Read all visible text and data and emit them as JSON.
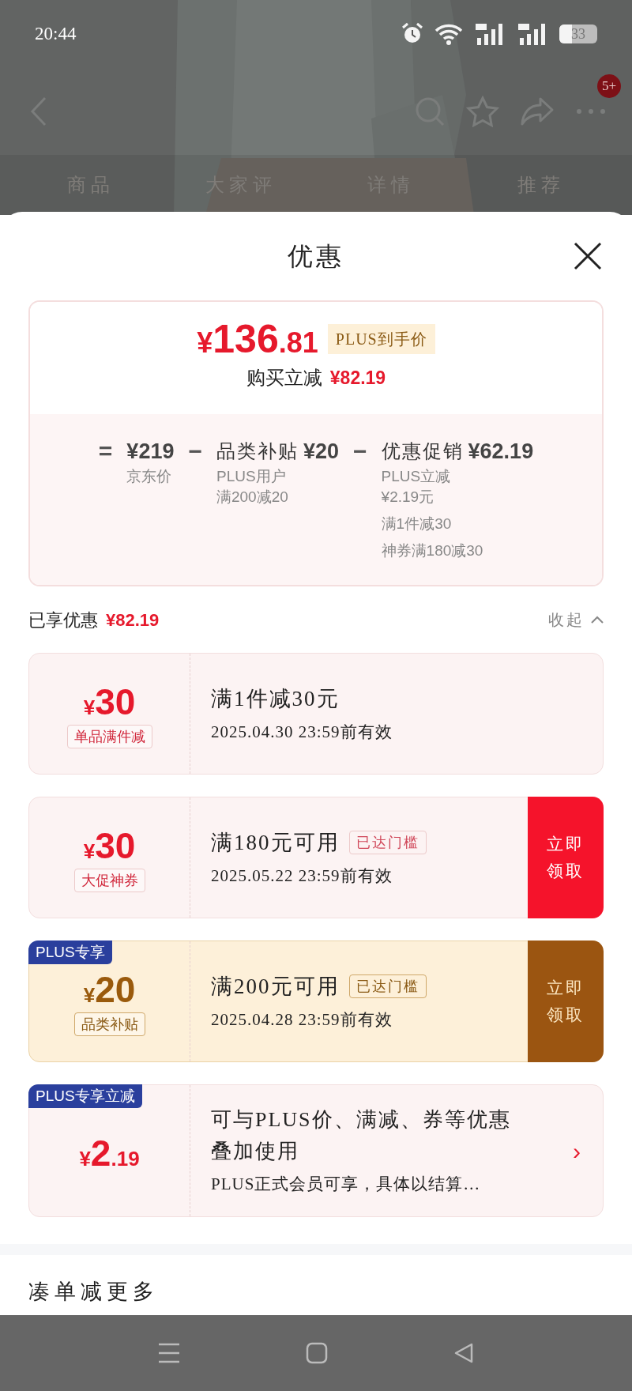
{
  "status_bar": {
    "time": "20:44",
    "battery": "33"
  },
  "nav": {
    "badge": "5+"
  },
  "tabs": [
    {
      "label": "商品"
    },
    {
      "label": "大家评"
    },
    {
      "label": "详情"
    },
    {
      "label": "推荐"
    }
  ],
  "sheet": {
    "title": "优惠"
  },
  "price_summary": {
    "currency": "¥",
    "integer": "136",
    "decimal": ".81",
    "tag": "PLUS到手价",
    "save_label": "购买立减",
    "save_amount": "¥82.19"
  },
  "breakdown": {
    "equals": "=",
    "items": [
      {
        "amount": "¥219",
        "notes": [
          [
            "京东价"
          ]
        ]
      },
      {
        "operator": "−",
        "label": "品类补贴",
        "amount": "¥20",
        "notes": [
          [
            "PLUS用户",
            "满200减20"
          ]
        ]
      },
      {
        "operator": "−",
        "label": "优惠促销",
        "amount": "¥62.19",
        "notes": [
          [
            "PLUS立减",
            "¥2.19元"
          ],
          [
            "满1件减30"
          ],
          [
            "神券满180减30"
          ]
        ]
      }
    ]
  },
  "enjoyed": {
    "label": "已享优惠",
    "amount": "¥82.19",
    "toggle": "收起"
  },
  "coupons": [
    {
      "kind": "coupon",
      "currency": "¥",
      "amount": "30",
      "tag": "单品满件减",
      "title": "满1件减30元",
      "validity": "2025.04.30 23:59前有效"
    },
    {
      "kind": "coupon",
      "currency": "¥",
      "amount": "30",
      "tag": "大促神券",
      "title": "满180元可用",
      "threshold": "已达门槛",
      "validity": "2025.05.22 23:59前有效",
      "action": [
        "立即",
        "领取"
      ]
    },
    {
      "kind": "plus",
      "badge": "PLUS专享",
      "currency": "¥",
      "amount": "20",
      "tag": "品类补贴",
      "title": "满200元可用",
      "threshold": "已达门槛",
      "validity": "2025.04.28 23:59前有效",
      "action": [
        "立即",
        "领取"
      ]
    },
    {
      "kind": "plus_instant",
      "badge": "PLUS专享立减",
      "currency": "¥",
      "amount": "2",
      "decimal": ".19",
      "title": "可与PLUS价、满减、券等优惠叠加使用",
      "note": "PLUS正式会员可享，具体以结算…",
      "chevron": "›"
    }
  ],
  "footer_heading": "凑单减更多"
}
